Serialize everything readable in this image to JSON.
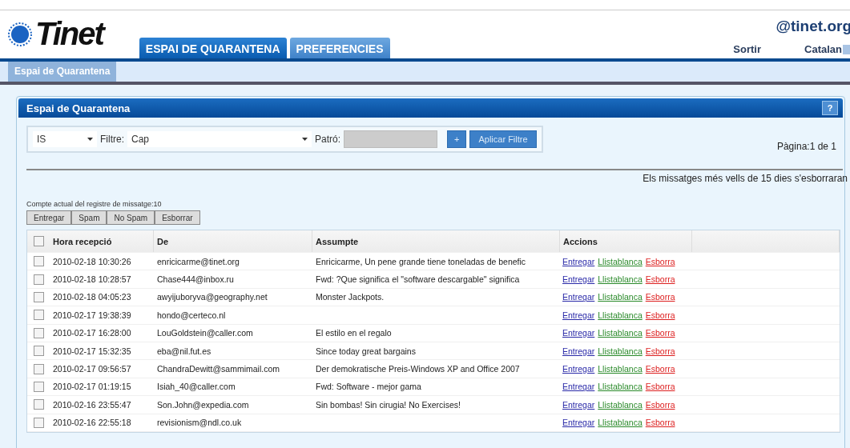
{
  "header": {
    "logo": "Tinet",
    "account": "@tinet.org",
    "logout": "Sortir",
    "language": "Catalan"
  },
  "tabs": [
    {
      "label": "ESPAI DE QUARANTENA",
      "selected": true
    },
    {
      "label": "PREFERENCIES",
      "selected": false
    }
  ],
  "subnav": [
    {
      "label": "Espai de Quarantena",
      "selected": true
    }
  ],
  "panel": {
    "title": "Espai de Quarantena",
    "help": "?",
    "filter": {
      "field": "IS",
      "filter_label": "Filtre:",
      "filter_value": "Cap",
      "pattern_label": "Patró:",
      "add": "+",
      "apply": "Aplicar Filtre"
    },
    "page": "Pàgina:1 de 1",
    "notice": "Els missatges més vells de 15 dies s'esborraran",
    "count": "Compte actual del registre de missatge:10",
    "actions": [
      "Entregar",
      "Spam",
      "No Spam",
      "Esborrar"
    ],
    "table": {
      "columns": [
        "Hora recepció",
        "De",
        "Assumpte",
        "Accions"
      ],
      "select_all_checked": false,
      "rows": [
        {
          "checked": false,
          "time": "2010-02-18 10:30:26",
          "from": "enricicarme@tinet.org",
          "subject": "Enricicarme, Un pene grande tiene toneladas de benefic",
          "actions": [
            {
              "label": "Entregar",
              "kind": "deliver"
            },
            {
              "label": "Llistablanca",
              "kind": "whitelist"
            },
            {
              "label": "Esborra",
              "kind": "delete"
            }
          ]
        },
        {
          "checked": false,
          "time": "2010-02-18 10:28:57",
          "from": "Chase444@inbox.ru",
          "subject": "Fwd: ?Que significa el \"software descargable\" significa",
          "actions": [
            {
              "label": "Entregar",
              "kind": "deliver"
            },
            {
              "label": "Llistablanca",
              "kind": "whitelist"
            },
            {
              "label": "Esborra",
              "kind": "delete"
            }
          ]
        },
        {
          "checked": false,
          "time": "2010-02-18 04:05:23",
          "from": "awyijuboryva@geography.net",
          "subject": "Monster Jackpots.",
          "actions": [
            {
              "label": "Entregar",
              "kind": "deliver"
            },
            {
              "label": "Llistablanca",
              "kind": "whitelist"
            },
            {
              "label": "Esborra",
              "kind": "delete"
            }
          ]
        },
        {
          "checked": false,
          "time": "2010-02-17 19:38:39",
          "from": "hondo@certeco.nl",
          "actions": [
            {
              "label": "Entregar",
              "kind": "deliver"
            },
            {
              "label": "Llistablanca",
              "kind": "whitelist"
            },
            {
              "label": "Esborra",
              "kind": "delete"
            }
          ]
        },
        {
          "checked": false,
          "time": "2010-02-17 16:28:00",
          "from": "LouGoldstein@caller.com",
          "subject": "El estilo en el regalo",
          "actions": [
            {
              "label": "Entregar",
              "kind": "deliver"
            },
            {
              "label": "Llistablanca",
              "kind": "whitelist"
            },
            {
              "label": "Esborra",
              "kind": "delete"
            }
          ]
        },
        {
          "checked": false,
          "time": "2010-02-17 15:32:35",
          "from": "eba@nil.fut.es",
          "subject": "Since today great bargains",
          "actions": [
            {
              "label": "Entregar",
              "kind": "deliver"
            },
            {
              "label": "Llistablanca",
              "kind": "whitelist"
            },
            {
              "label": "Esborra",
              "kind": "delete"
            }
          ]
        },
        {
          "checked": false,
          "time": "2010-02-17 09:56:57",
          "from": "ChandraDewitt@sammimail.com",
          "subject": "Der demokratische Preis-Windows XP and Office 2007",
          "actions": [
            {
              "label": "Entregar",
              "kind": "deliver"
            },
            {
              "label": "Llistablanca",
              "kind": "whitelist"
            },
            {
              "label": "Esborra",
              "kind": "delete"
            }
          ]
        },
        {
          "checked": false,
          "time": "2010-02-17 01:19:15",
          "from": "Isiah_40@caller.com",
          "subject": "Fwd: Software - mejor gama",
          "actions": [
            {
              "label": "Entregar",
              "kind": "deliver"
            },
            {
              "label": "Llistablanca",
              "kind": "whitelist"
            },
            {
              "label": "Esborra",
              "kind": "delete"
            }
          ]
        },
        {
          "checked": false,
          "time": "2010-02-16 23:55:47",
          "from": "Son.John@expedia.com",
          "subject": "Sin bombas! Sin cirugia! No Exercises!",
          "actions": [
            {
              "label": "Entregar",
              "kind": "deliver"
            },
            {
              "label": "Llistablanca",
              "kind": "whitelist"
            },
            {
              "label": "Esborra",
              "kind": "delete"
            }
          ]
        },
        {
          "checked": false,
          "time": "2010-02-16 22:55:18",
          "from": "revisionism@ndl.co.uk",
          "actions": [
            {
              "label": "Entregar",
              "kind": "deliver"
            },
            {
              "label": "Llistablanca",
              "kind": "whitelist"
            },
            {
              "label": "Esborra",
              "kind": "delete"
            }
          ]
        }
      ]
    }
  }
}
